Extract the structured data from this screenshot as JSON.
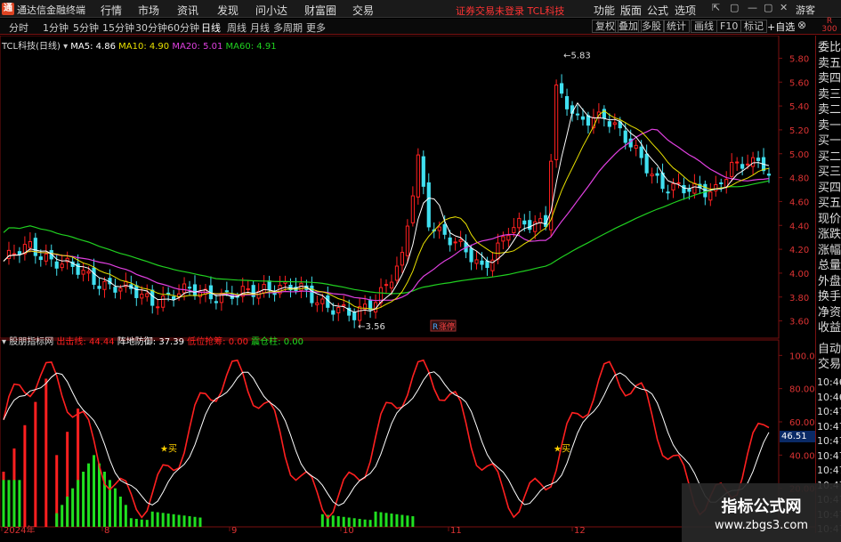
{
  "app": {
    "name": "通达信金融终端",
    "logo": "通"
  },
  "menu": [
    "行情",
    "市场",
    "资讯",
    "发现",
    "问小达",
    "财富圈",
    "交易"
  ],
  "warning": "证券交易未登录  TCL科技",
  "right_menu": [
    "功能",
    "版面",
    "公式",
    "选项"
  ],
  "window_buttons": [
    "⇱",
    "▢",
    "—",
    "▢",
    "✕"
  ],
  "guest": "游客",
  "periods": [
    "分时",
    "1分钟",
    "5分钟",
    "15分钟",
    "30分钟",
    "60分钟",
    "日线",
    "周线",
    "月线",
    "多周期",
    "更多"
  ],
  "active_period": "日线",
  "tool_buttons": [
    "复权",
    "叠加",
    "多股",
    "统计",
    "画线",
    "F10",
    "标记"
  ],
  "add_fav": "+自选",
  "close_glyph": "⊗",
  "r_label": "R\n300",
  "stock": {
    "name": "TCL科技(日线)",
    "caret": "▾"
  },
  "ma": [
    {
      "label": "MA5: 4.86",
      "color": "#ffffff"
    },
    {
      "label": "MA10: 4.90",
      "color": "#e8e000"
    },
    {
      "label": "MA20: 5.01",
      "color": "#e040e0"
    },
    {
      "label": "MA60: 4.91",
      "color": "#20d020"
    }
  ],
  "indicator": {
    "name": "股朋指标网",
    "items": [
      {
        "label": "出击线: 44.44",
        "color": "#ff2020"
      },
      {
        "label": "阵地防御: 37.39",
        "color": "#ffffff"
      },
      {
        "label": "低位抢筹: 0.00",
        "color": "#ff2020"
      },
      {
        "label": "震仓柱: 0.00",
        "color": "#20e020"
      }
    ]
  },
  "price_axis": [
    "5.80",
    "5.60",
    "5.40",
    "5.20",
    "5.00",
    "4.80",
    "4.60",
    "4.40",
    "4.20",
    "4.00",
    "3.80",
    "3.60"
  ],
  "indicator_axis": [
    "100.0",
    "80.00",
    "60.00",
    "40.00",
    "20.00"
  ],
  "current_value": "46.51",
  "annotations": {
    "high": "5.83",
    "low": "3.56",
    "zt": "涨停",
    "zt_mark": "R",
    "buy": "买",
    "star": "★"
  },
  "date_axis": [
    "2024年",
    "8",
    "9",
    "10",
    "11",
    "12"
  ],
  "right_panel": [
    "委比",
    "卖五",
    "卖四",
    "卖三",
    "卖二",
    "卖一",
    "买一",
    "买二",
    "买三",
    "买四",
    "买五",
    "现价",
    "涨跌",
    "涨幅",
    "总量",
    "外盘",
    "换手",
    "净资",
    "收益"
  ],
  "right_panel_tabs": [
    "自动",
    "交易"
  ],
  "right_times": [
    "10:46",
    "10:46",
    "10:47",
    "10:47",
    "10:47",
    "10:47",
    "10:47",
    "10:47",
    "10:47",
    "10:47",
    "10:47"
  ],
  "watermark": {
    "line1": "指标公式网",
    "line2": "www.zbgs3.com"
  },
  "colors": {
    "up": "#ff2020",
    "down": "#40e0f0",
    "ma5": "#ffffff",
    "ma10": "#e8e000",
    "ma20": "#e040e0",
    "ma60": "#20d020",
    "grid": "#7a1010"
  }
}
